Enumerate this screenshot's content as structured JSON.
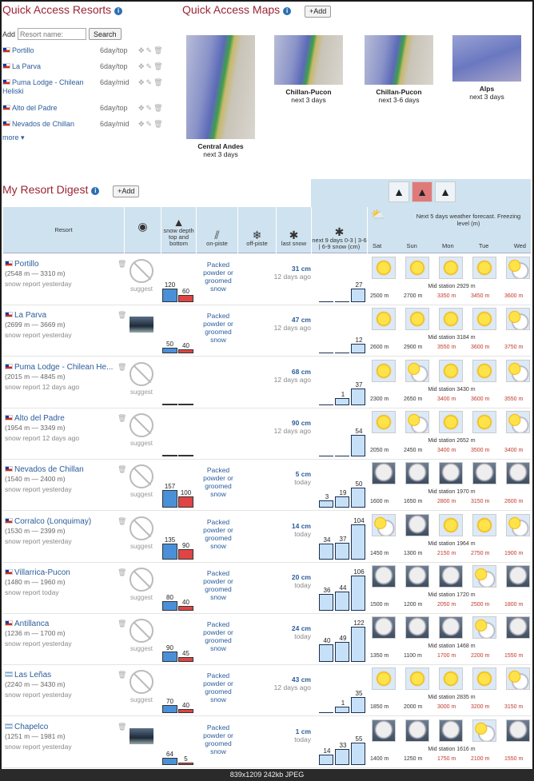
{
  "quick_resorts": {
    "title": "Quick Access Resorts",
    "add_label": "Add",
    "search_placeholder": "Resort name:",
    "search_button": "Search",
    "items": [
      {
        "name": "Portillo",
        "freq": "6day/top",
        "flag": "cl"
      },
      {
        "name": "La Parva",
        "freq": "6day/top",
        "flag": "cl"
      },
      {
        "name": "Puma Lodge - Chilean Heliski",
        "freq": "6day/mid",
        "flag": "cl"
      },
      {
        "name": "Alto del Padre",
        "freq": "6day/top",
        "flag": "cl"
      },
      {
        "name": "Nevados de Chillan",
        "freq": "6day/mid",
        "flag": "cl"
      }
    ],
    "more_label": "more ▾"
  },
  "quick_maps": {
    "title": "Quick Access Maps",
    "add_button": "+Add",
    "maps": [
      {
        "name": "Central Andes",
        "period": "next 3 days"
      },
      {
        "name": "Chillan-Pucon",
        "period": "next 3 days"
      },
      {
        "name": "Chillan-Pucon",
        "period": "next 3-6 days"
      },
      {
        "name": "Alps",
        "period": "next 3 days"
      }
    ]
  },
  "digest": {
    "title": "My Resort Digest",
    "add_button": "+Add",
    "columns": {
      "resort": "Resort",
      "depth": "snow depth top and bottom",
      "onpiste": "on-piste",
      "offpiste": "off-piste",
      "last": "last snow",
      "next9": "next 9 days 0-3 | 3-6 | 6-9 snow (cm)",
      "weather": "Next 5 days weather forecast. Freezing level (m)"
    },
    "days": [
      "Sat",
      "Sun",
      "Mon",
      "Tue",
      "Wed"
    ],
    "suggest_label": "suggest",
    "rows": [
      {
        "name": "Portillo",
        "flag": "cl",
        "elev": "(2548 m — 3310 m)",
        "report": "snow report yesterday",
        "cam": "none",
        "top": "120",
        "bottom": "60",
        "piste": "Packed powder or groomed snow",
        "last_cm": "31 cm",
        "last_when": "12 days ago",
        "n9": [
          "",
          "",
          "27"
        ],
        "wx": [
          "sun",
          "sun",
          "sun",
          "sun",
          "pc"
        ],
        "mid": "Mid station 2929 m",
        "frz": [
          "2500 m",
          "2700 m",
          "3350 m",
          "3450 m",
          "3600 m"
        ]
      },
      {
        "name": "La Parva",
        "flag": "cl",
        "elev": "(2699 m — 3669 m)",
        "report": "snow report yesterday",
        "cam": "img",
        "top": "50",
        "bottom": "40",
        "piste": "Packed powder or groomed snow",
        "last_cm": "47 cm",
        "last_when": "12 days ago",
        "n9": [
          "",
          "",
          "12"
        ],
        "wx": [
          "sun",
          "sun",
          "sun",
          "sun",
          "pc"
        ],
        "mid": "Mid station 3184 m",
        "frz": [
          "2600 m",
          "2900 m",
          "3550 m",
          "3600 m",
          "3750 m"
        ]
      },
      {
        "name": "Puma Lodge - Chilean He...",
        "flag": "cl",
        "elev": "(2015 m — 4845 m)",
        "report": "snow report 12 days ago",
        "cam": "none",
        "top": "",
        "bottom": "",
        "piste": "",
        "last_cm": "68 cm",
        "last_when": "12 days ago",
        "n9": [
          "",
          "1",
          "37"
        ],
        "wx": [
          "sun",
          "pc",
          "sun",
          "sun",
          "pc"
        ],
        "mid": "Mid station 3430 m",
        "frz": [
          "2300 m",
          "2650 m",
          "3400 m",
          "3600 m",
          "3550 m"
        ]
      },
      {
        "name": "Alto del Padre",
        "flag": "cl",
        "elev": "(1954 m — 3349 m)",
        "report": "snow report 12 days ago",
        "cam": "none",
        "top": "",
        "bottom": "",
        "piste": "",
        "last_cm": "90 cm",
        "last_when": "12 days ago",
        "n9": [
          "",
          "",
          "54"
        ],
        "wx": [
          "sun",
          "pc",
          "sun",
          "sun",
          "pc"
        ],
        "mid": "Mid station 2652 m",
        "frz": [
          "2050 m",
          "2450 m",
          "3400 m",
          "3500 m",
          "3400 m"
        ]
      },
      {
        "name": "Nevados de Chillan",
        "flag": "cl",
        "elev": "(1540 m — 2400 m)",
        "report": "snow report yesterday",
        "cam": "none",
        "top": "157",
        "bottom": "100",
        "piste": "Packed powder or groomed snow",
        "last_cm": "5 cm",
        "last_when": "today",
        "n9": [
          "3",
          "19",
          "50"
        ],
        "wx": [
          "cl",
          "cl",
          "cl",
          "cl",
          "cl"
        ],
        "mid": "Mid station 1970 m",
        "frz": [
          "1600 m",
          "1650 m",
          "2800 m",
          "3150 m",
          "2600 m"
        ]
      },
      {
        "name": "Corralco (Lonquimay)",
        "flag": "cl",
        "elev": "(1530 m — 2399 m)",
        "report": "snow report yesterday",
        "cam": "none",
        "top": "135",
        "bottom": "90",
        "piste": "Packed powder or groomed snow",
        "last_cm": "14 cm",
        "last_when": "today",
        "n9": [
          "34",
          "37",
          "104"
        ],
        "wx": [
          "pc",
          "cl",
          "sun",
          "sun",
          "pc"
        ],
        "mid": "Mid station 1964 m",
        "frz": [
          "1450 m",
          "1300 m",
          "2150 m",
          "2750 m",
          "1900 m"
        ]
      },
      {
        "name": "Villarrica-Pucon",
        "flag": "cl",
        "elev": "(1480 m — 1960 m)",
        "report": "snow report today",
        "cam": "none",
        "top": "80",
        "bottom": "40",
        "piste": "Packed powder or groomed snow",
        "last_cm": "20 cm",
        "last_when": "today",
        "n9": [
          "36",
          "44",
          "106"
        ],
        "wx": [
          "cl",
          "cl",
          "cl",
          "pc",
          "cl"
        ],
        "mid": "Mid station 1720 m",
        "frz": [
          "1500 m",
          "1200 m",
          "2050 m",
          "2500 m",
          "1800 m"
        ]
      },
      {
        "name": "Antillanca",
        "flag": "cl",
        "elev": "(1236 m — 1700 m)",
        "report": "snow report yesterday",
        "cam": "none",
        "top": "90",
        "bottom": "45",
        "piste": "Packed powder or groomed snow",
        "last_cm": "24 cm",
        "last_when": "today",
        "n9": [
          "40",
          "49",
          "122"
        ],
        "wx": [
          "cl",
          "cl",
          "cl",
          "pc",
          "cl"
        ],
        "mid": "Mid station 1468 m",
        "frz": [
          "1350 m",
          "1100 m",
          "1700 m",
          "2200 m",
          "1550 m"
        ]
      },
      {
        "name": "Las Leñas",
        "flag": "ar",
        "elev": "(2240 m — 3430 m)",
        "report": "snow report yesterday",
        "cam": "none",
        "top": "70",
        "bottom": "40",
        "piste": "Packed powder or groomed snow",
        "last_cm": "43 cm",
        "last_when": "12 days ago",
        "n9": [
          "",
          "1",
          "35"
        ],
        "wx": [
          "sun",
          "sun",
          "sun",
          "sun",
          "pc"
        ],
        "mid": "Mid station 2835 m",
        "frz": [
          "1850 m",
          "2000 m",
          "3000 m",
          "3200 m",
          "3150 m"
        ]
      },
      {
        "name": "Chapelco",
        "flag": "ar",
        "elev": "(1251 m — 1981 m)",
        "report": "snow report yesterday",
        "cam": "img",
        "top": "64",
        "bottom": "5",
        "piste": "Packed powder or groomed snow",
        "last_cm": "1 cm",
        "last_when": "today",
        "n9": [
          "14",
          "33",
          "55"
        ],
        "wx": [
          "cl",
          "cl",
          "cl",
          "pc",
          "cl"
        ],
        "mid": "Mid station 1616 m",
        "frz": [
          "1400 m",
          "1250 m",
          "1750 m",
          "2100 m",
          "1550 m"
        ]
      }
    ]
  },
  "footer": "839x1209 242kb JPEG"
}
